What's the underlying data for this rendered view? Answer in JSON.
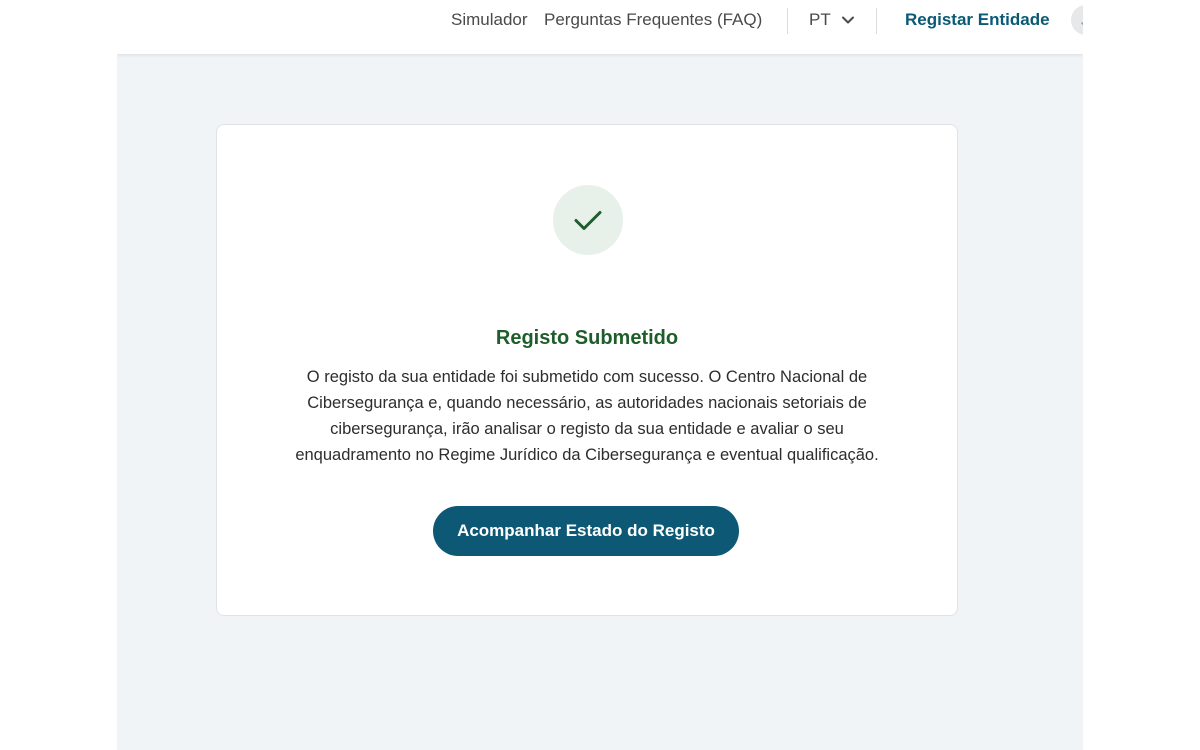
{
  "header": {
    "nav": {
      "simulador": "Simulador",
      "faq": "Perguntas Frequentes (FAQ)"
    },
    "language": {
      "selected": "PT",
      "icon": "chevron-down-icon"
    },
    "register_link": "Registar Entidade",
    "avatar_initial": "J"
  },
  "confirmation": {
    "icon": "check-icon",
    "title": "Registo Submetido",
    "message": "O registo da sua entidade foi submetido com sucesso. O Centro Nacional de Cibersegurança e, quando necessário, as autoridades nacionais setoriais de cibersegurança, irão analisar o registo da sua entidade e avaliar o seu enquadramento no Regime Jurídico da Cibersegurança e eventual qualificação.",
    "button_label": "Acompanhar Estado do Registo"
  },
  "colors": {
    "accent": "#0d5975",
    "success_title": "#1f5e2b",
    "success_circle": "#e8f0ea",
    "page_background": "#f1f4f6"
  }
}
